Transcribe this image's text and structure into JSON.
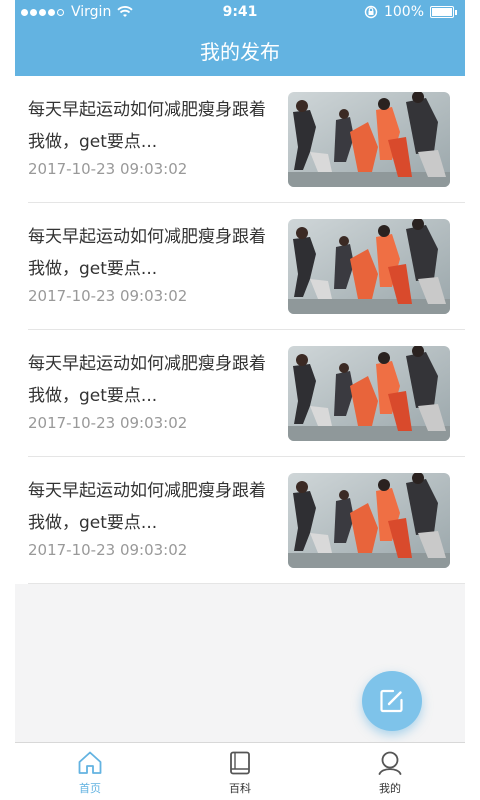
{
  "status_bar": {
    "carrier": "Virgin",
    "time": "9:41",
    "battery": "100%"
  },
  "header": {
    "title": "我的发布"
  },
  "posts": [
    {
      "title": "每天早起运动如何减肥瘦身跟着我做，get要点...",
      "time": "2017-10-23  09:03:02"
    },
    {
      "title": "每天早起运动如何减肥瘦身跟着我做，get要点...",
      "time": "2017-10-23  09:03:02"
    },
    {
      "title": "每天早起运动如何减肥瘦身跟着我做，get要点...",
      "time": "2017-10-23  09:03:02"
    },
    {
      "title": "每天早起运动如何减肥瘦身跟着我做，get要点...",
      "time": "2017-10-23  09:03:02"
    }
  ],
  "fab": {
    "icon": "edit-icon"
  },
  "tabs": [
    {
      "label": "首页",
      "icon": "home-icon",
      "active": true
    },
    {
      "label": "百科",
      "icon": "book-icon",
      "active": false
    },
    {
      "label": "我的",
      "icon": "user-icon",
      "active": false
    }
  ],
  "colors": {
    "primary": "#63b3e1",
    "background": "#f4f4f5",
    "text": "#333333",
    "subtext": "#999999"
  }
}
